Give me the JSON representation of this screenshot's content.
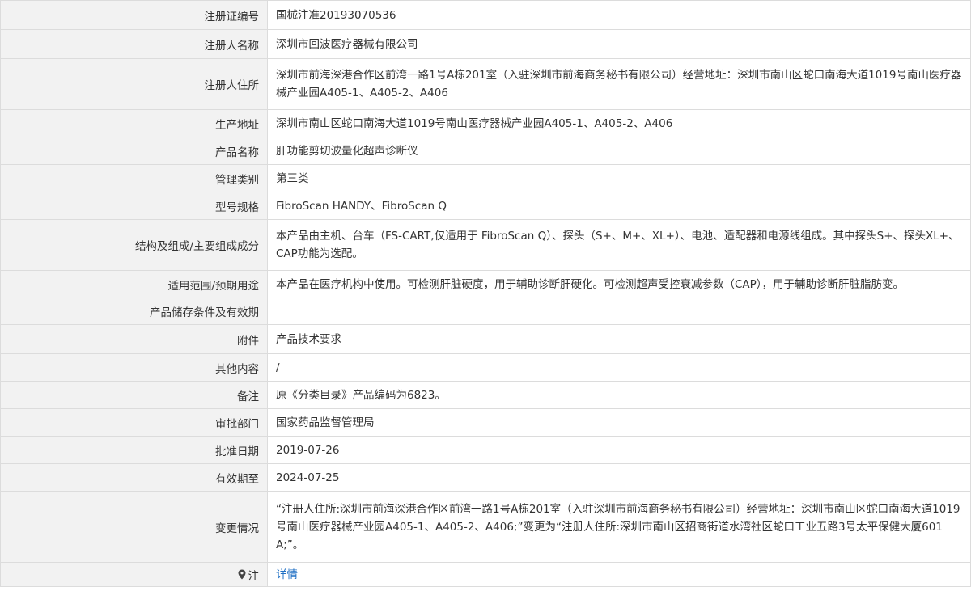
{
  "rows": [
    {
      "label": "注册证编号",
      "value": "国械注准20193070536"
    },
    {
      "label": "注册人名称",
      "value": "深圳市回波医疗器械有限公司"
    },
    {
      "label": "注册人住所",
      "value": "深圳市前海深港合作区前湾一路1号A栋201室（入驻深圳市前海商务秘书有限公司）经营地址：深圳市南山区蛇口南海大道1019号南山医疗器械产业园A405-1、A405-2、A406"
    },
    {
      "label": "生产地址",
      "value": "深圳市南山区蛇口南海大道1019号南山医疗器械产业园A405-1、A405-2、A406"
    },
    {
      "label": "产品名称",
      "value": "肝功能剪切波量化超声诊断仪"
    },
    {
      "label": "管理类别",
      "value": "第三类"
    },
    {
      "label": "型号规格",
      "value": "FibroScan HANDY、FibroScan Q"
    },
    {
      "label": "结构及组成/主要组成成分",
      "value": "本产品由主机、台车（FS-CART,仅适用于 FibroScan Q）、探头（S+、M+、XL+）、电池、适配器和电源线组成。其中探头S+、探头XL+、CAP功能为选配。"
    },
    {
      "label": "适用范围/预期用途",
      "value": "本产品在医疗机构中使用。可检测肝脏硬度，用于辅助诊断肝硬化。可检测超声受控衰减参数（CAP），用于辅助诊断肝脏脂肪变。"
    },
    {
      "label": "产品储存条件及有效期",
      "value": ""
    },
    {
      "label": "附件",
      "value": "产品技术要求"
    },
    {
      "label": "其他内容",
      "value": "/"
    },
    {
      "label": "备注",
      "value": "原《分类目录》产品编码为6823。"
    },
    {
      "label": "审批部门",
      "value": "国家药品监督管理局"
    },
    {
      "label": "批准日期",
      "value": "2019-07-26"
    },
    {
      "label": "有效期至",
      "value": "2024-07-25"
    },
    {
      "label": "变更情况",
      "value": "“注册人住所:深圳市前海深港合作区前湾一路1号A栋201室（入驻深圳市前海商务秘书有限公司）经营地址：深圳市南山区蛇口南海大道1019号南山医疗器械产业园A405-1、A405-2、A406;”变更为“注册人住所:深圳市南山区招商街道水湾社区蛇口工业五路3号太平保健大厦601A;”。"
    },
    {
      "label": "注",
      "value": "详情"
    }
  ],
  "icons": {
    "note": "location-pin-icon"
  }
}
